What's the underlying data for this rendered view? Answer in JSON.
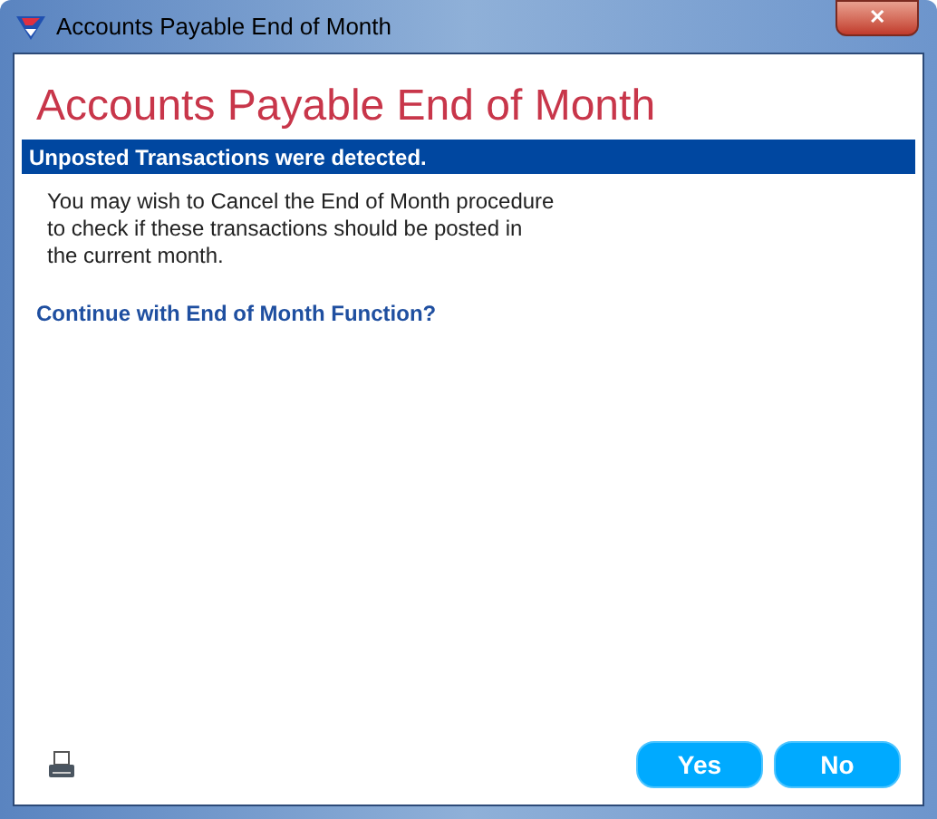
{
  "window": {
    "title": "Accounts Payable End of Month",
    "close": "✕"
  },
  "heading": "Accounts Payable End of Month",
  "banner": "Unposted Transactions were detected.",
  "message": "You may wish to Cancel the End of Month procedure to check if these transactions should be posted in the current month.",
  "question": "Continue with End of Month Function?",
  "buttons": [
    {
      "label": "Yes"
    },
    {
      "label": "No"
    }
  ]
}
